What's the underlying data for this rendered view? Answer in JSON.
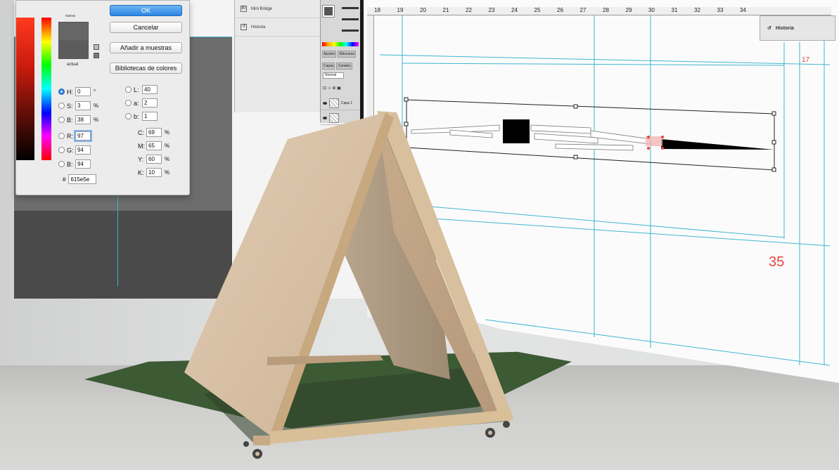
{
  "color_picker": {
    "label_new": "nueva",
    "label_current": "actual",
    "ok_label": "OK",
    "cancel_label": "Cancelar",
    "add_swatches_label": "Añadir a muestras",
    "color_libraries_label": "Bibliotecas de colores",
    "hsb": [
      {
        "label": "H:",
        "value": "0",
        "unit": "°"
      },
      {
        "label": "S:",
        "value": "3",
        "unit": "%"
      },
      {
        "label": "B:",
        "value": "38",
        "unit": "%"
      }
    ],
    "rgb": [
      {
        "label": "R:",
        "value": "97"
      },
      {
        "label": "G:",
        "value": "94"
      },
      {
        "label": "B:",
        "value": "94"
      }
    ],
    "lab": [
      {
        "label": "L:",
        "value": "40"
      },
      {
        "label": "a:",
        "value": "2"
      },
      {
        "label": "b:",
        "value": "1"
      }
    ],
    "cmyk": [
      {
        "label": "C:",
        "value": "69",
        "unit": "%"
      },
      {
        "label": "M:",
        "value": "65",
        "unit": "%"
      },
      {
        "label": "Y:",
        "value": "60",
        "unit": "%"
      },
      {
        "label": "K:",
        "value": "10",
        "unit": "%"
      }
    ],
    "hex_label": "#",
    "hex_value": "615e5e"
  },
  "panels": {
    "mini_bridge": "Mini Bridge",
    "historia": "Historia",
    "historia_right": "Historia",
    "tab_ajustes": "Ajustes",
    "tab_mascaras": "Máscaras",
    "tab_capas": "Capas",
    "tab_canales": "Canales",
    "blend_mode": "Normal",
    "layer_name": "Capa 1"
  },
  "document": {
    "ruler_numbers": [
      "18",
      "19",
      "20",
      "21",
      "22",
      "23",
      "24",
      "25",
      "26",
      "27",
      "28",
      "29",
      "30",
      "31",
      "32",
      "33",
      "34"
    ],
    "page_number_small": "17",
    "page_number_large": "35"
  },
  "colors": {
    "accent_blue": "#2b86e5",
    "guide_cyan": "#3fb6d1",
    "page_number_red": "#e2463e",
    "wood": "#d9c2a7"
  }
}
